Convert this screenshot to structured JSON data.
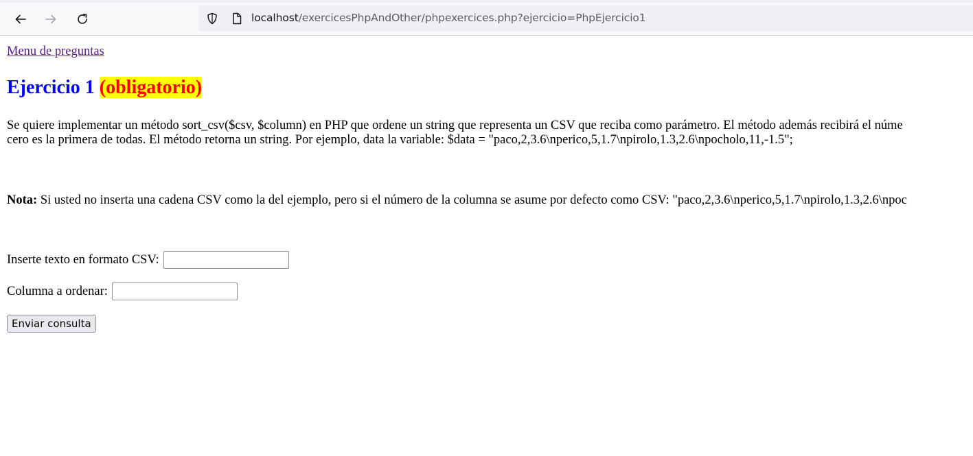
{
  "browser": {
    "url_host": "localhost",
    "url_path": "/exercicesPhpAndOther/phpexercices.php?ejercicio=PhpEjercicio1"
  },
  "page": {
    "menu_link": "Menu de preguntas",
    "title_main": "Ejercicio 1",
    "title_tag": "(obligatorio)",
    "paragraph_1_line_1": "Se quiere implementar un método sort_csv($csv, $column) en PHP que ordene un string que representa un CSV que reciba como parámetro. El método además recibirá el núme",
    "paragraph_1_line_2": "cero es la primera de todas. El método retorna un string. Por ejemplo, data la variable: $data = \"paco,2,3.6\\nperico,5,1.7\\npirolo,1.3,2.6\\npocholo,11,-1.5\";",
    "note_label": "Nota:",
    "note_text": " Si usted no inserta una cadena CSV como la del ejemplo, pero si el número de la columna se asume por defecto como CSV: \"paco,2,3.6\\nperico,5,1.7\\npirolo,1.3,2.6\\npoc"
  },
  "form": {
    "csv_label": "Inserte texto en formato CSV:",
    "csv_value": "",
    "column_label": "Columna a ordenar:",
    "column_value": "",
    "submit_label": "Enviar consulta"
  },
  "colors": {
    "title": "#0000ff",
    "tag_text": "#ff0000",
    "tag_background": "#ffff00",
    "link_visited": "#551a8b"
  },
  "icons": [
    "back-arrow-icon",
    "forward-arrow-icon",
    "reload-icon",
    "shield-icon",
    "page-icon"
  ]
}
